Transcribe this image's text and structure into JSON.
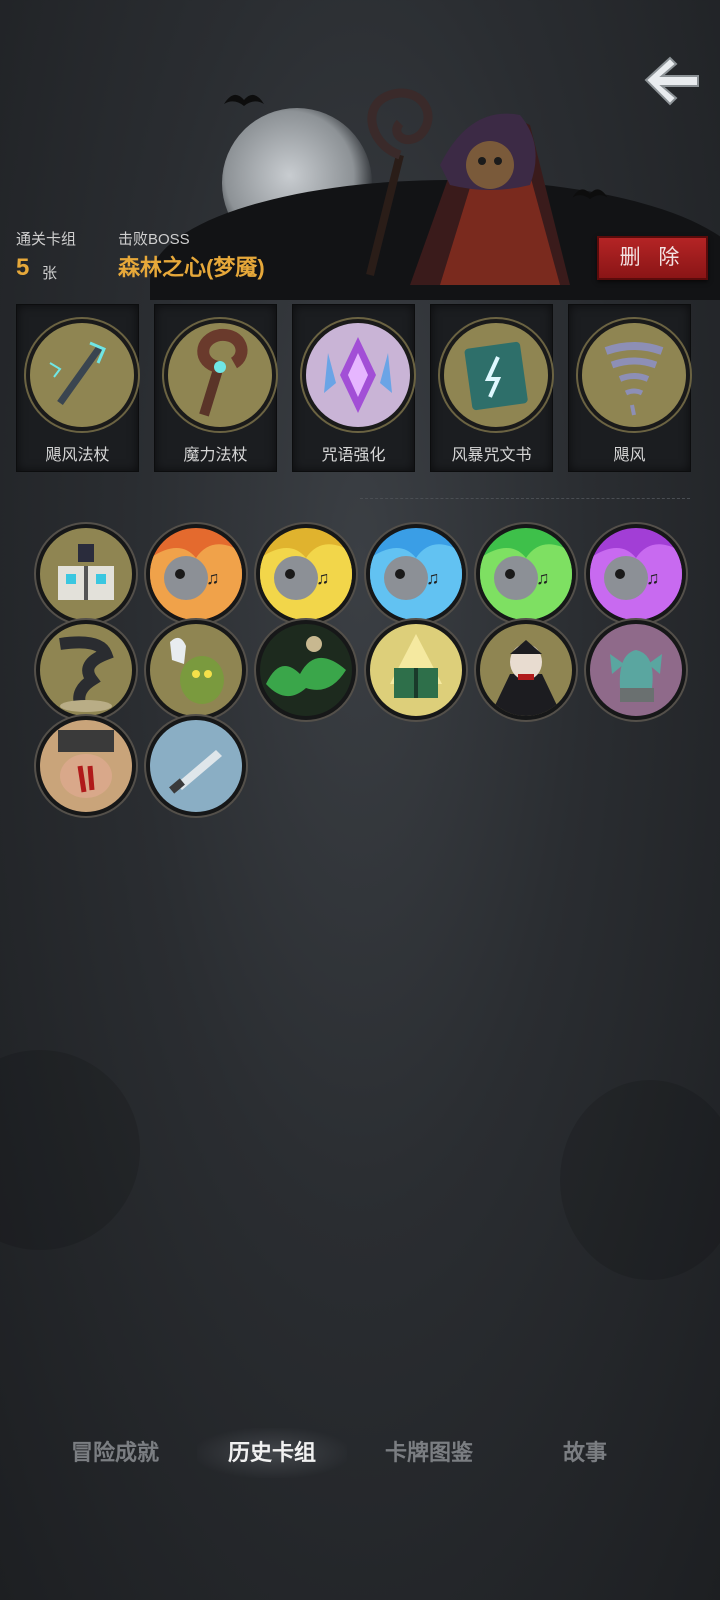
{
  "header": {
    "deck_label": "通关卡组",
    "deck_count": "5",
    "deck_unit": "张",
    "boss_label": "击败BOSS",
    "boss_name": "森林之心(梦魇)",
    "delete_label": "删 除"
  },
  "deck_cards": [
    {
      "label": "飓风法杖",
      "icon": "lightning-staff-icon"
    },
    {
      "label": "魔力法杖",
      "icon": "magic-staff-icon"
    },
    {
      "label": "咒语强化",
      "icon": "purple-crystal-icon"
    },
    {
      "label": "风暴咒文书",
      "icon": "storm-book-icon"
    },
    {
      "label": "飓风",
      "icon": "tornado-icon"
    }
  ],
  "history_icons": [
    "cursed-book-icon",
    "skull-red-flame-icon",
    "skull-yellow-flame-icon",
    "skull-blue-flame-icon",
    "skull-green-flame-icon",
    "skull-purple-flame-icon",
    "black-tornado-icon",
    "ghost-ogre-icon",
    "green-mist-icon",
    "glowing-book-icon",
    "vampire-icon",
    "gargoyle-icon",
    "bloody-fist-icon",
    "dagger-icon"
  ],
  "tabs": [
    {
      "label": "冒险成就",
      "active": false
    },
    {
      "label": "历史卡组",
      "active": true
    },
    {
      "label": "卡牌图鉴",
      "active": false
    },
    {
      "label": "故事",
      "active": false
    }
  ],
  "colors": {
    "accent_gold": "#e6a83a",
    "delete_red": "#b42425",
    "medal_olive": "#8f8552"
  }
}
